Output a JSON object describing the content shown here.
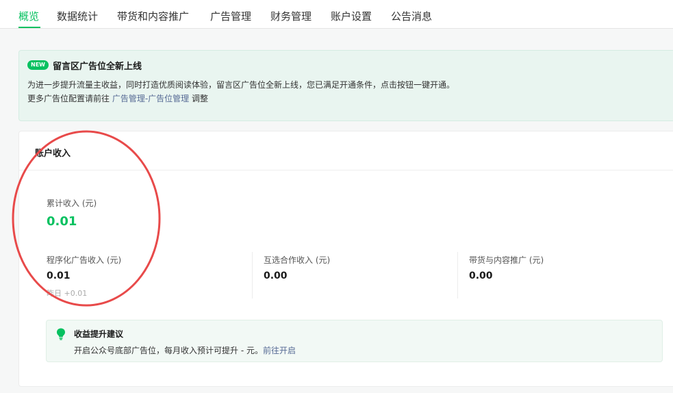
{
  "nav": {
    "tabs": [
      {
        "label": "概览",
        "active": true
      },
      {
        "label": "数据统计",
        "active": false
      },
      {
        "label": "带货和内容推广",
        "active": false
      },
      {
        "label": "广告管理",
        "active": false
      },
      {
        "label": "财务管理",
        "active": false
      },
      {
        "label": "账户设置",
        "active": false
      },
      {
        "label": "公告消息",
        "active": false
      }
    ]
  },
  "notice": {
    "badge": "NEW",
    "title": "留言区广告位全新上线",
    "line1": "为进一步提升流量主收益，同时打造优质阅读体验，留言区广告位全新上线，您已满足开通条件，点击按钮一键开通。",
    "line2_prefix": "更多广告位配置请前往 ",
    "line2_link": "广告管理-广告位管理",
    "line2_suffix": " 调整"
  },
  "income": {
    "title": "账户收入",
    "total_label": "累计收入 (元)",
    "total_value": "0.01",
    "metrics": [
      {
        "label": "程序化广告收入 (元)",
        "value": "0.01",
        "sub": "昨日 +0.01"
      },
      {
        "label": "互选合作收入 (元)",
        "value": "0.00"
      },
      {
        "label": "带货与内容推广 (元)",
        "value": "0.00"
      }
    ]
  },
  "suggestion": {
    "icon": "lightbulb-icon",
    "title": "收益提升建议",
    "text": "开启公众号底部广告位，每月收入预计可提升 - 元。",
    "link": "前往开启"
  },
  "colors": {
    "accent": "#07c160",
    "link": "#576b95",
    "annotation": "#e84a4a"
  }
}
